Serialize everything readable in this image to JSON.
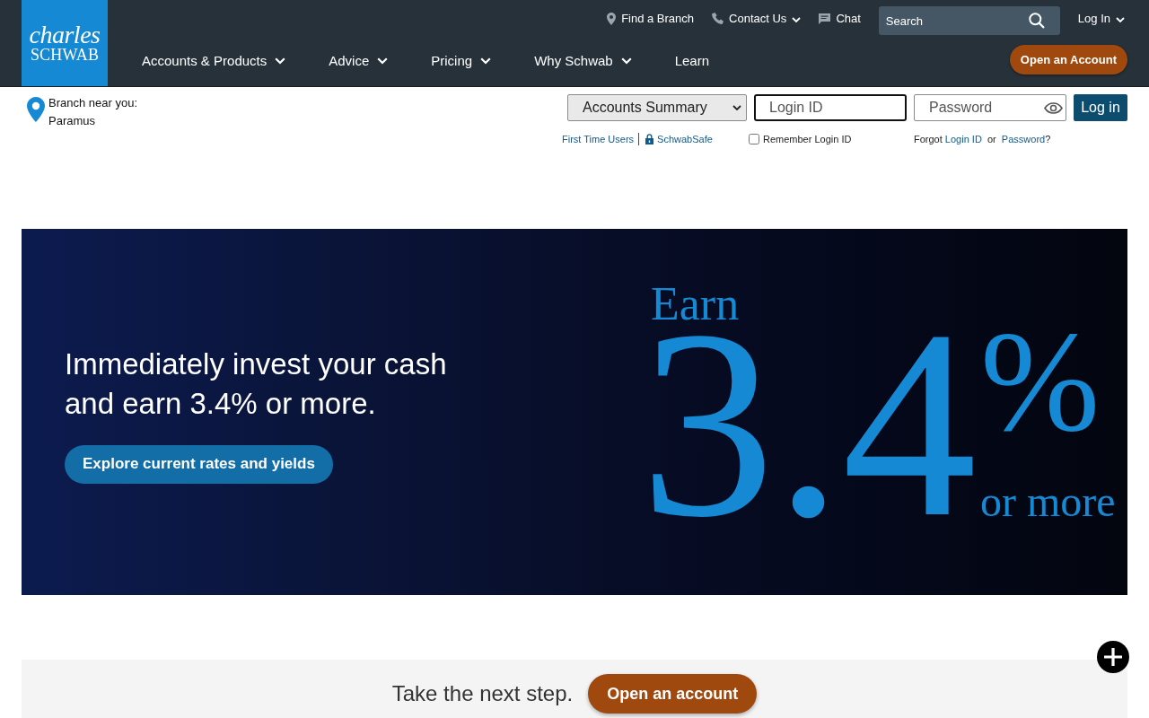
{
  "header": {
    "logo": {
      "line_1": "charles",
      "line_2": "SCHWAB"
    },
    "utility_links": [
      {
        "kind": "location",
        "label": "Find a Branch",
        "dropdown": false
      },
      {
        "kind": "phone",
        "label": "Contact Us",
        "dropdown": true
      },
      {
        "kind": "chat",
        "label": "Chat",
        "dropdown": false
      }
    ],
    "search": {
      "placeholder": "Search"
    },
    "login_menu": {
      "label": "Log In",
      "dropdown": true
    },
    "nav": [
      {
        "label": "Accounts & Products",
        "dropdown": true
      },
      {
        "label": "Advice",
        "dropdown": true
      },
      {
        "label": "Pricing",
        "dropdown": true
      },
      {
        "label": "Why Schwab",
        "dropdown": true
      },
      {
        "label": "Learn",
        "dropdown": false
      }
    ],
    "cta": "Open an Account"
  },
  "branch": {
    "label": "Branch near you:",
    "name": "Paramus"
  },
  "login": {
    "destination": "Accounts Summary",
    "login_id": {
      "placeholder": "Login ID",
      "focused": true
    },
    "password": {
      "placeholder": "Password"
    },
    "submit": "Log in",
    "first_time_link": "First Time Users",
    "safe_link": "SchwabSafe",
    "remember": {
      "label": "Remember Login ID",
      "checked": false
    },
    "forgot": {
      "text": "Forgot",
      "login_id_link": "Login ID",
      "or": "or",
      "password_link": "Password",
      "end": "?"
    }
  },
  "banner": {
    "headline": "Immediately invest your cash and earn 3.4% or more.",
    "button": "Explore current rates and yields",
    "graphic": {
      "lead": "Earn",
      "figure": "3.4",
      "unit": "%",
      "tail": "or more"
    }
  },
  "footer_cta": {
    "text": "Take the next step.",
    "button": "Open an account"
  }
}
